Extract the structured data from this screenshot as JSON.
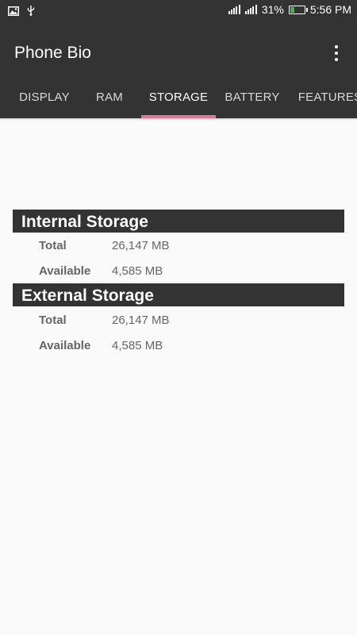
{
  "status_bar": {
    "left_icons": [
      "image-icon",
      "usb-icon"
    ],
    "battery_percent": "31%",
    "battery_level": 0.31,
    "time": "5:56 PM"
  },
  "app_bar": {
    "title": "Phone Bio",
    "menu_icon": "overflow-menu-icon"
  },
  "tabs": [
    {
      "label": "DISPLAY",
      "active": false
    },
    {
      "label": "RAM",
      "active": false
    },
    {
      "label": "STORAGE",
      "active": true
    },
    {
      "label": "BATTERY",
      "active": false
    },
    {
      "label": "FEATURES",
      "active": false
    }
  ],
  "colors": {
    "toolbar": "#333333",
    "indicator": "#e5749d",
    "background": "#fafafa",
    "text_secondary": "#666666",
    "battery_fill": "#4caf50"
  },
  "internal_storage": {
    "title": "Internal Storage",
    "total_label": "Total",
    "total_value": "26,147 MB",
    "available_label": "Available",
    "available_value": "4,585 MB"
  },
  "external_storage": {
    "title": "External Storage",
    "total_label": "Total",
    "total_value": "26,147 MB",
    "available_label": "Available",
    "available_value": "4,585 MB"
  }
}
